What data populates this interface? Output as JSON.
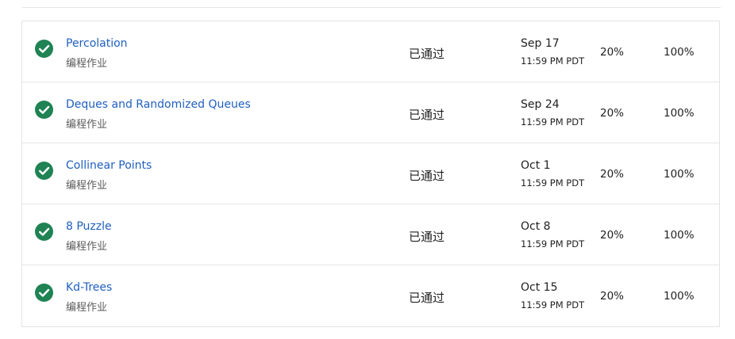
{
  "colors": {
    "check_green": "#1f8354",
    "link_blue": "#1f5fbf"
  },
  "assignments": [
    {
      "icon": "check-circle-icon",
      "title": "Percolation",
      "type": "编程作业",
      "status": "已通过",
      "due_date": "Sep 17",
      "due_time": "11:59 PM PDT",
      "weight": "20%",
      "grade": "100%"
    },
    {
      "icon": "check-circle-icon",
      "title": "Deques and Randomized Queues",
      "type": "编程作业",
      "status": "已通过",
      "due_date": "Sep 24",
      "due_time": "11:59 PM PDT",
      "weight": "20%",
      "grade": "100%"
    },
    {
      "icon": "check-circle-icon",
      "title": "Collinear Points",
      "type": "编程作业",
      "status": "已通过",
      "due_date": "Oct 1",
      "due_time": "11:59 PM PDT",
      "weight": "20%",
      "grade": "100%"
    },
    {
      "icon": "check-circle-icon",
      "title": "8 Puzzle",
      "type": "编程作业",
      "status": "已通过",
      "due_date": "Oct 8",
      "due_time": "11:59 PM PDT",
      "weight": "20%",
      "grade": "100%"
    },
    {
      "icon": "check-circle-icon",
      "title": "Kd-Trees",
      "type": "编程作业",
      "status": "已通过",
      "due_date": "Oct 15",
      "due_time": "11:59 PM PDT",
      "weight": "20%",
      "grade": "100%"
    }
  ]
}
